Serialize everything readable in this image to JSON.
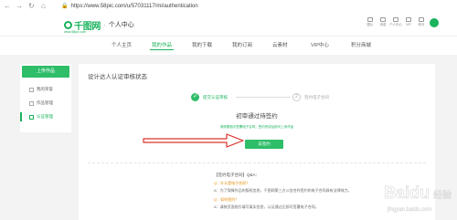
{
  "browser": {
    "url": "https://www.58pic.com/u/57031117/mi/authentication",
    "back_icon": "arrow-left-icon",
    "forward_icon": "arrow-right-icon",
    "reload_icon": "reload-icon",
    "home_icon": "home-icon",
    "lock_icon": "lock-icon"
  },
  "header": {
    "logo_text": "千图网",
    "separator": "·",
    "subtitle": "个人中心",
    "logo_tagline": "www.58pic.com",
    "tools": [
      {
        "label": "图片",
        "icon": "image-icon"
      },
      {
        "label": "消息",
        "icon": "message-icon"
      },
      {
        "label": "个人中心",
        "icon": "user-icon"
      },
      {
        "label": "VIP",
        "icon": "diamond-icon"
      },
      {
        "label": "积分",
        "icon": "coin-icon"
      }
    ]
  },
  "tabs": [
    {
      "label": "个人主页"
    },
    {
      "label": "我的作品"
    },
    {
      "label": "我的下载"
    },
    {
      "label": "我的订阅"
    },
    {
      "label": "云素材"
    },
    {
      "label": "VIP中心"
    },
    {
      "label": "积分商城"
    }
  ],
  "sidebar": {
    "upload_label": "上传作品",
    "items": [
      {
        "label": "我的荣誉"
      },
      {
        "label": "作品管理"
      },
      {
        "label": "认证管理"
      }
    ]
  },
  "main": {
    "title": "设计达人认证审核状态",
    "step1_label": "提交认证审核",
    "step2_num": "2",
    "step2_label": "签约电子合同",
    "status_title": "初审通过待签约",
    "status_sub": "请按照指引签署电子合同，签约完成后即可上传作品",
    "sign_button": "去签约",
    "qa_title": "【签约电子合同】Q&A：",
    "qa_lines": [
      {
        "type": "q",
        "text": "Q：什么是电子合同？"
      },
      {
        "type": "a",
        "text": "A：为了保障作品的版权信息，千图网第三方公信合作签约的电子合同具有法律效力。"
      },
      {
        "type": "q",
        "text": "Q：如何签约？"
      },
      {
        "type": "a",
        "text": "A：请按页面指引填写真实信息，认证通过后即可签署电子合同。"
      }
    ]
  },
  "watermark": {
    "brand": "Baidu",
    "sub": "经验",
    "url": "jingyan.baidu.com"
  },
  "colors": {
    "accent": "#1ab35c",
    "button": "#2ebd69",
    "arrow": "#d9342b",
    "page_bg": "#f3f3f3"
  }
}
